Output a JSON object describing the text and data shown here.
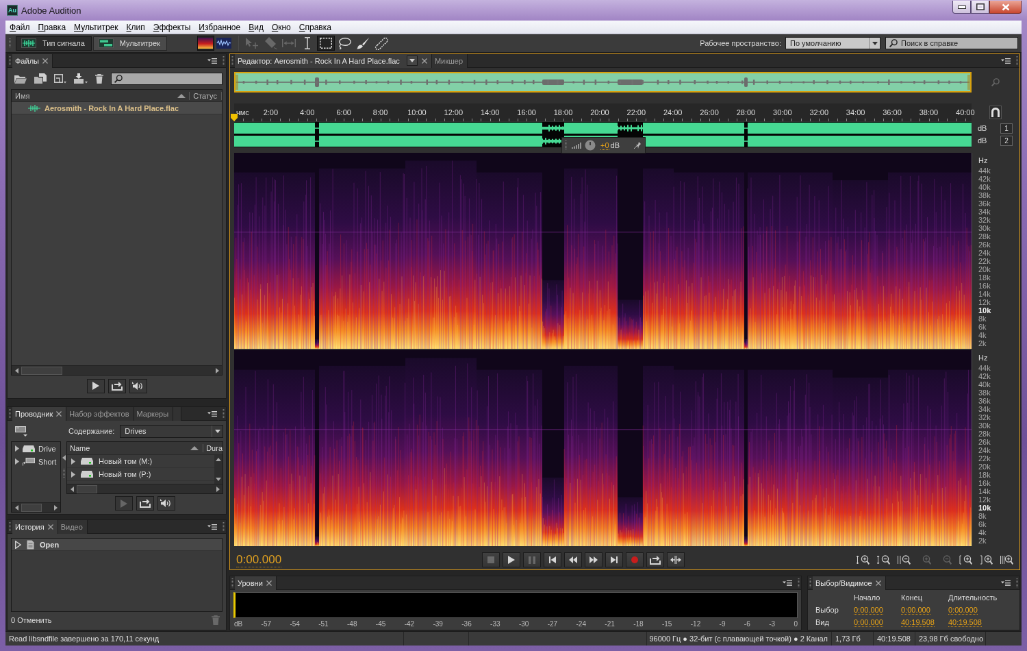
{
  "window": {
    "logo": "Au",
    "title": "Adobe Audition"
  },
  "menu": [
    "Файл",
    "Правка",
    "Мультитрек",
    "Клип",
    "Эффекты",
    "Избранное",
    "Вид",
    "Окно",
    "Справка"
  ],
  "toolbar": {
    "views": [
      {
        "label": "Тип сигнала",
        "kind": "waveform",
        "selected": true
      },
      {
        "label": "Мультитрек",
        "kind": "multitrack",
        "selected": false
      }
    ],
    "display_modes": [
      {
        "kind": "spectral",
        "selected": true
      },
      {
        "kind": "waveform",
        "selected": false
      }
    ],
    "tools": [
      {
        "kind": "move",
        "disabled": true,
        "selected": false
      },
      {
        "kind": "razor",
        "disabled": true,
        "selected": false
      },
      {
        "kind": "slip",
        "disabled": true,
        "selected": false
      },
      {
        "kind": "time_selection",
        "disabled": false,
        "selected": false
      },
      {
        "kind": "marquee",
        "disabled": false,
        "selected": true
      },
      {
        "kind": "lasso",
        "disabled": false,
        "selected": false
      },
      {
        "kind": "brush",
        "disabled": false,
        "selected": false
      },
      {
        "kind": "spot_healing",
        "disabled": false,
        "selected": false
      }
    ],
    "workspace_label": "Рабочее пространство:",
    "workspace": "По умолчанию",
    "help_search": {
      "placeholder": "Поиск в справке"
    }
  },
  "files_panel": {
    "tabs": [
      {
        "label": "Файлы",
        "selected": true
      }
    ],
    "columns": [
      "Имя",
      "Статус"
    ],
    "rows": [
      {
        "name": "Aerosmith - Rock In A Hard Place.flac",
        "selected": true
      }
    ],
    "buttons": [
      {
        "kind": "play",
        "disabled": false
      },
      {
        "kind": "loop",
        "disabled": false
      },
      {
        "kind": "autoplay",
        "disabled": false
      }
    ]
  },
  "explorer_panel": {
    "tabs": [
      {
        "label": "Проводник",
        "selected": true
      },
      {
        "label": "Набор эффектов",
        "selected": false
      },
      {
        "label": "Маркеры",
        "selected": false
      }
    ],
    "content_label": "Содержание:",
    "content": "Drives",
    "tree": [
      {
        "label": "Drive",
        "expanded": false
      },
      {
        "label": "Short",
        "expanded": false
      }
    ],
    "columns": [
      "Name",
      "Dura"
    ],
    "rows": [
      {
        "label": "Новый том (M:)",
        "expanded": false
      },
      {
        "label": "Новый том (P:)",
        "expanded": false
      }
    ],
    "buttons": [
      {
        "kind": "play",
        "disabled": true
      },
      {
        "kind": "loop",
        "disabled": false
      },
      {
        "kind": "autoplay",
        "disabled": false
      }
    ]
  },
  "history_panel": {
    "tabs": [
      {
        "label": "История",
        "selected": true
      },
      {
        "label": "Видео",
        "selected": false
      }
    ],
    "items": [
      {
        "label": "Open",
        "selected": true
      }
    ],
    "undo_count": "0 Отменить",
    "delete": {
      "disabled": true
    }
  },
  "editor": {
    "tabs": [
      {
        "label": "Редактор: Aerosmith - Rock In A Hard Place.flac",
        "kind": "editor",
        "selected": true
      },
      {
        "label": "Микшер",
        "kind": "mixer",
        "selected": false
      }
    ],
    "overview_zoom": {
      "disabled": true
    },
    "time_unit": "чмс",
    "ruler": [
      "2:00",
      "4:00",
      "6:00",
      "8:00",
      "10:00",
      "12:00",
      "14:00",
      "16:00",
      "18:00",
      "20:00",
      "22:00",
      "24:00",
      "26:00",
      "28:00",
      "30:00",
      "32:00",
      "34:00",
      "36:00",
      "38:00",
      "40:00"
    ],
    "channels": [
      {
        "unit": "dB",
        "number": "1",
        "freq_unit": "Hz",
        "freq_labels": [
          {
            "label": "44k",
            "major": false
          },
          {
            "label": "42k",
            "major": false
          },
          {
            "label": "40k",
            "major": false
          },
          {
            "label": "38k",
            "major": false
          },
          {
            "label": "36k",
            "major": false
          },
          {
            "label": "34k",
            "major": false
          },
          {
            "label": "32k",
            "major": false
          },
          {
            "label": "30k",
            "major": false
          },
          {
            "label": "28k",
            "major": false
          },
          {
            "label": "26k",
            "major": false
          },
          {
            "label": "24k",
            "major": false
          },
          {
            "label": "22k",
            "major": false
          },
          {
            "label": "20k",
            "major": false
          },
          {
            "label": "18k",
            "major": false
          },
          {
            "label": "16k",
            "major": false
          },
          {
            "label": "14k",
            "major": false
          },
          {
            "label": "12k",
            "major": false
          },
          {
            "label": "10k",
            "major": true
          },
          {
            "label": "8k",
            "major": false
          },
          {
            "label": "6k",
            "major": false
          },
          {
            "label": "4k",
            "major": false
          },
          {
            "label": "2k",
            "major": false
          }
        ]
      },
      {
        "unit": "dB",
        "number": "2",
        "freq_unit": "Hz",
        "freq_labels": [
          {
            "label": "44k",
            "major": false
          },
          {
            "label": "42k",
            "major": false
          },
          {
            "label": "40k",
            "major": false
          },
          {
            "label": "38k",
            "major": false
          },
          {
            "label": "36k",
            "major": false
          },
          {
            "label": "34k",
            "major": false
          },
          {
            "label": "32k",
            "major": false
          },
          {
            "label": "30k",
            "major": false
          },
          {
            "label": "28k",
            "major": false
          },
          {
            "label": "26k",
            "major": false
          },
          {
            "label": "24k",
            "major": false
          },
          {
            "label": "22k",
            "major": false
          },
          {
            "label": "20k",
            "major": false
          },
          {
            "label": "18k",
            "major": false
          },
          {
            "label": "16k",
            "major": false
          },
          {
            "label": "14k",
            "major": false
          },
          {
            "label": "12k",
            "major": false
          },
          {
            "label": "10k",
            "major": true
          },
          {
            "label": "8k",
            "major": false
          },
          {
            "label": "6k",
            "major": false
          },
          {
            "label": "4k",
            "major": false
          },
          {
            "label": "2k",
            "major": false
          }
        ]
      }
    ],
    "hud": {
      "value": "+0",
      "unit": "dB"
    },
    "time": "0:00.000",
    "transport": [
      {
        "kind": "stop",
        "disabled": true
      },
      {
        "kind": "play",
        "disabled": false
      },
      {
        "kind": "pause",
        "disabled": true
      },
      {
        "kind": "to_start",
        "disabled": false
      },
      {
        "kind": "rewind",
        "disabled": false
      },
      {
        "kind": "forward",
        "disabled": false
      },
      {
        "kind": "to_end",
        "disabled": false
      },
      {
        "kind": "record",
        "disabled": false
      },
      {
        "kind": "loop",
        "disabled": false
      },
      {
        "kind": "skip",
        "disabled": false
      }
    ],
    "zoom": [
      {
        "kind": "zoom_in_amplitude",
        "disabled": false
      },
      {
        "kind": "zoom_out_amplitude",
        "disabled": false
      },
      {
        "kind": "zoom_out_full",
        "disabled": false
      },
      {
        "kind": "zoom_in",
        "disabled": true
      },
      {
        "kind": "zoom_out",
        "disabled": true
      },
      {
        "kind": "zoom_in_start",
        "disabled": false
      },
      {
        "kind": "zoom_in_end",
        "disabled": false
      },
      {
        "kind": "zoom_selection",
        "disabled": false
      }
    ]
  },
  "levels_panel": {
    "tabs": [
      {
        "label": "Уровни",
        "selected": true
      }
    ],
    "scale": [
      "dB",
      "-57",
      "-54",
      "-51",
      "-48",
      "-45",
      "-42",
      "-39",
      "-36",
      "-33",
      "-30",
      "-27",
      "-24",
      "-21",
      "-18",
      "-15",
      "-12",
      "-9",
      "-6",
      "-3",
      "0"
    ]
  },
  "selection_panel": {
    "tabs": [
      {
        "label": "Выбор/Видимое",
        "selected": true
      }
    ],
    "columns": [
      "Начало",
      "Конец",
      "Длительность"
    ],
    "rows": [
      {
        "label": "Выбор",
        "start": "0:00.000",
        "end": "0:00.000",
        "duration": "0:00.000"
      },
      {
        "label": "Вид",
        "start": "0:00.000",
        "end": "40:19.508",
        "duration": "40:19.508"
      }
    ]
  },
  "status_bar": {
    "message": "Read libsndfile завершено за 170,11 секунд",
    "format": "96000 Гц ● 32-бит (с плавающей точкой) ● 2 Канал",
    "size": "1,73 Гб",
    "duration": "40:19.508",
    "free": "23,98 Гб свободно"
  }
}
